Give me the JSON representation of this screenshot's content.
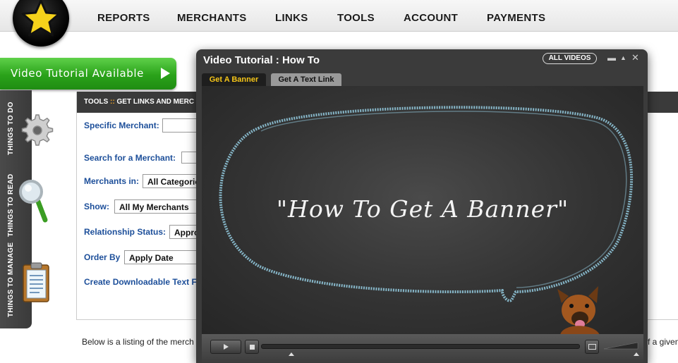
{
  "nav": {
    "items": [
      "REPORTS",
      "MERCHANTS",
      "LINKS",
      "TOOLS",
      "ACCOUNT",
      "PAYMENTS"
    ]
  },
  "logo": {
    "icon": "star-icon",
    "color": "#f5d21b"
  },
  "video_banner": {
    "label": "Video Tutorial Available",
    "icon": "play-icon"
  },
  "sidebar": {
    "items": [
      {
        "label": "THINGS TO DO",
        "icon": "gear-icon"
      },
      {
        "label": "THINGS TO READ",
        "icon": "magnifier-icon"
      },
      {
        "label": "THINGS TO MANAGE",
        "icon": "clipboard-icon"
      }
    ]
  },
  "panel": {
    "title_prefix": "TOOLS",
    "title_sep": "::",
    "title_rest": "GET LINKS AND MERC",
    "fields": {
      "specific_merchant": {
        "label": "Specific Merchant:",
        "value": ""
      },
      "search_merchant": {
        "label": "Search for a Merchant:",
        "value": ""
      },
      "merchants_in": {
        "label": "Merchants in:",
        "value": "All Categories"
      },
      "show": {
        "label": "Show:",
        "value": "All My Merchants"
      },
      "relationship": {
        "label": "Relationship Status:",
        "value": "Approved"
      },
      "order_by": {
        "label": "Order By",
        "value": "Apply Date"
      }
    },
    "download_link": "Create Downloadable Text F"
  },
  "below_text": "Below is a listing of the merch",
  "below_text_end": "f a given",
  "video_window": {
    "title": "Video Tutorial : How To",
    "all_videos": "ALL VIDEOS",
    "controls": {
      "minimize": "minimize-icon",
      "up": "up-icon",
      "close": "close-icon"
    },
    "tabs": [
      {
        "label": "Get A Banner",
        "active": true
      },
      {
        "label": "Get A Text Link",
        "active": false
      }
    ],
    "caption": "\"How To Get A Banner\"",
    "player": {
      "play": "play-icon",
      "stop": "stop-icon",
      "screen": "fullscreen-icon",
      "progress": 0.0
    }
  },
  "colors": {
    "accent_green": "#2aa21a",
    "label_blue": "#1d4f9a",
    "tab_active_text": "#f5c518",
    "chalk_blue": "#8fc4d8"
  }
}
